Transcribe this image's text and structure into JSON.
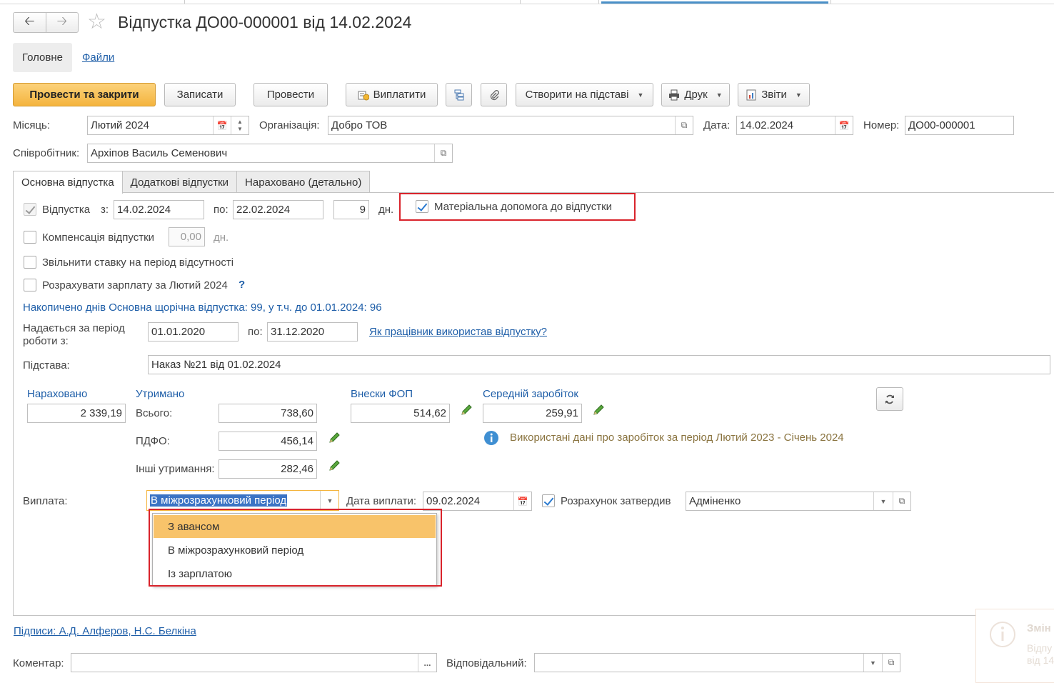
{
  "window": {
    "title": "Відпустка ДО00-000001 від 14.02.2024"
  },
  "section_tabs": {
    "main": "Головне",
    "files": "Файли"
  },
  "toolbar": {
    "post_close": "Провести та закрити",
    "save": "Записати",
    "post": "Провести",
    "pay": "Виплатити",
    "create_based": "Створити на підставі",
    "print": "Друк",
    "reports": "Звіти"
  },
  "header": {
    "month_label": "Місяць:",
    "month_value": "Лютий 2024",
    "org_label": "Організація:",
    "org_value": "Добро ТОВ",
    "date_label": "Дата:",
    "date_value": "14.02.2024",
    "number_label": "Номер:",
    "number_value": "ДО00-000001",
    "employee_label": "Співробітник:",
    "employee_value": "Архіпов Василь Семенович"
  },
  "doc_tabs": [
    "Основна відпустка",
    "Додаткові відпустки",
    "Нараховано (детально)"
  ],
  "vacation": {
    "label": "Відпустка",
    "from_label": "з:",
    "from": "14.02.2024",
    "to_label": "по:",
    "to": "22.02.2024",
    "days": "9",
    "days_unit": "дн.",
    "material_help": "Матеріальна допомога до відпустки",
    "compensation_label": "Компенсація відпустки",
    "compensation_value": "0,00",
    "compensation_unit": "дн.",
    "release_rate": "Звільнити ставку на період відсутності",
    "calc_salary": "Розрахувати зарплату за Лютий 2024",
    "help_mark": "?",
    "accumulated": "Накопичено днів Основна щорічна відпустка: 99, у т.ч. до 01.01.2024: 96",
    "period_label": "Надається за період роботи з:",
    "period_from": "01.01.2020",
    "period_to_label": "по:",
    "period_to": "31.12.2020",
    "how_used_link": "Як працівник використав відпустку?",
    "basis_label": "Підстава:",
    "basis_value": "Наказ №21 від 01.02.2024"
  },
  "totals": {
    "accrued_title": "Нараховано",
    "accrued_value": "2 339,19",
    "withheld_title": "Утримано",
    "total_label": "Всього:",
    "total_value": "738,60",
    "pdfo_label": "ПДФО:",
    "pdfo_value": "456,14",
    "other_label": "Інші утримання:",
    "other_value": "282,46",
    "fop_title": "Внески ФОП",
    "fop_value": "514,62",
    "avg_title": "Середній заробіток",
    "avg_value": "259,91",
    "info_text": "Використані дані про заробіток за період Лютий 2023 - Січень 2024"
  },
  "payment": {
    "label": "Виплата:",
    "value": "В міжрозрахунковий період",
    "date_label": "Дата виплати:",
    "date_value": "09.02.2024",
    "approved_label": "Розрахунок затвердив",
    "approved_value": "Адміненко",
    "options": [
      "З авансом",
      "В міжрозрахунковий період",
      "Із зарплатою"
    ]
  },
  "footer": {
    "signatures": "Підписи: А.Д. Алферов, Н.С. Белкіна",
    "comment_label": "Коментар:",
    "responsible_label": "Відповідальний:",
    "ellipsis": "..."
  },
  "notification": {
    "title": "Змін",
    "line1": "Відпу",
    "line2": "від 14"
  },
  "colors": {
    "accent": "#f4b43e",
    "link": "#1e5ea8",
    "highlight": "#d9232b",
    "selected": "#f8c36a"
  }
}
